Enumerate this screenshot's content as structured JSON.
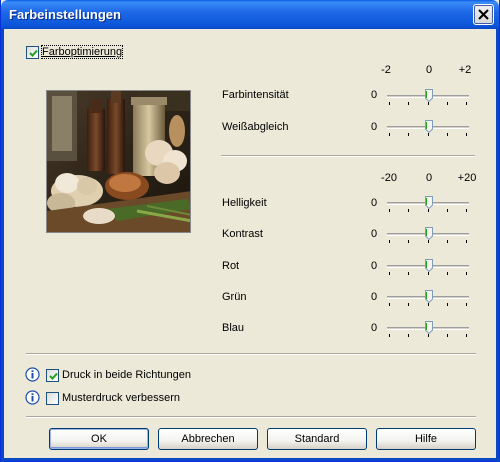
{
  "window": {
    "title": "Farbeinstellungen"
  },
  "colors": {
    "title_bar": "#0b55d9",
    "dialog_bg": "#ece9d8",
    "accent": "#21a121"
  },
  "color_optimization": {
    "label": "Farboptimierung",
    "checked": true
  },
  "top_scale": {
    "min": "-2",
    "mid": "0",
    "max": "+2"
  },
  "top_sliders": [
    {
      "label": "Farbintensität",
      "value": "0",
      "position": 0.5
    },
    {
      "label": "Weißabgleich",
      "value": "0",
      "position": 0.5
    }
  ],
  "bottom_scale": {
    "min": "-20",
    "mid": "0",
    "max": "+20"
  },
  "bottom_sliders": [
    {
      "label": "Helligkeit",
      "value": "0",
      "position": 0.5
    },
    {
      "label": "Kontrast",
      "value": "0",
      "position": 0.5
    },
    {
      "label": "Rot",
      "value": "0",
      "position": 0.5
    },
    {
      "label": "Grün",
      "value": "0",
      "position": 0.5
    },
    {
      "label": "Blau",
      "value": "0",
      "position": 0.5
    }
  ],
  "options": {
    "bidirectional": {
      "label": "Druck in beide Richtungen",
      "checked": true
    },
    "pattern": {
      "label": "Musterdruck verbessern",
      "checked": false
    }
  },
  "buttons": {
    "ok": "OK",
    "cancel": "Abbrechen",
    "default": "Standard",
    "help": "Hilfe"
  }
}
